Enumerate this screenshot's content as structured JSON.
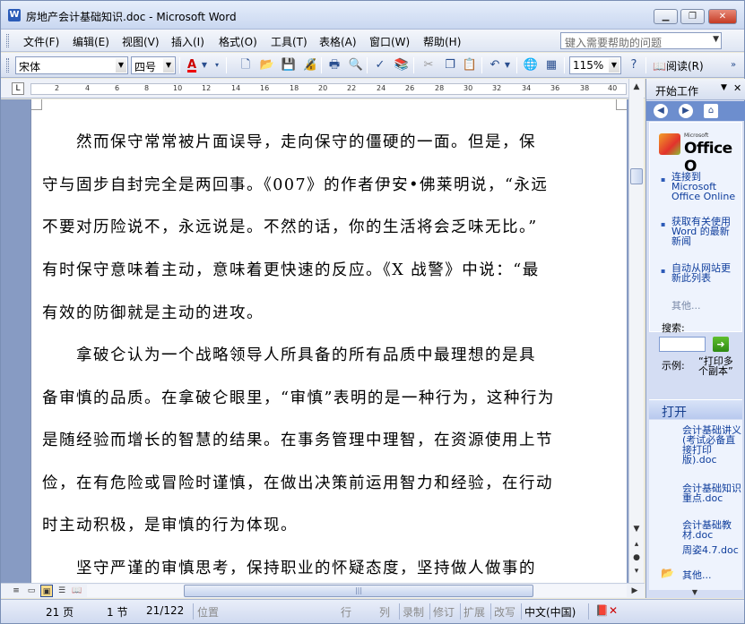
{
  "window": {
    "title": "房地产会计基础知识.doc - Microsoft Word",
    "app_icon": "W",
    "min_icon": "▁",
    "max_icon": "❐",
    "close_icon": "✕"
  },
  "menu": {
    "items": [
      "文件(F)",
      "编辑(E)",
      "视图(V)",
      "插入(I)",
      "格式(O)",
      "工具(T)",
      "表格(A)",
      "窗口(W)",
      "帮助(H)"
    ],
    "help_placeholder": "键入需要帮助的问题"
  },
  "toolbar": {
    "font_name": "宋体",
    "font_size": "四号",
    "font_color_letter": "A",
    "zoom": "115%",
    "read_label": "阅读(R)",
    "icons": [
      "new-icon",
      "open-icon",
      "save-icon",
      "permission-icon",
      "print-icon",
      "print-preview-icon",
      "spelling-icon",
      "research-icon",
      "cut-icon",
      "copy-icon",
      "paste-icon",
      "undo-icon",
      "hyperlink-icon",
      "table-icon",
      "help-icon"
    ]
  },
  "ruler": {
    "corner": "L",
    "ticks": [
      "2",
      "4",
      "6",
      "8",
      "10",
      "12",
      "14",
      "16",
      "18",
      "20",
      "22",
      "24",
      "26",
      "28",
      "30",
      "32",
      "34",
      "36",
      "38",
      "40"
    ]
  },
  "document": {
    "lines": [
      "　　然而保守常常被片面误导，走向保守的僵硬的一面。但是，保",
      "守与固步自封完全是两回事。《007》的作者伊安•佛莱明说，“永远",
      "不要对历险说不，永远说是。不然的话，你的生活将会乏味无比。”",
      "有时保守意味着主动，意味着更快速的反应。《X 战警》中说：“最",
      "有效的防御就是主动的进攻。",
      "　　拿破仑认为一个战略领导人所具备的所有品质中最理想的是具",
      "备审慎的品质。在拿破仑眼里，“审慎”表明的是一种行为，这种行为",
      "是随经验而增长的智慧的结果。在事务管理中理智，在资源使用上节",
      "俭，在有危险或冒险时谨慎，在做出决策前运用智力和经验，在行动",
      "时主动积极，是审慎的行为体现。",
      "　　坚守严谨的审慎思考，保持职业的怀疑态度，坚持做人做事的"
    ]
  },
  "taskpane": {
    "title": "开始工作",
    "office_small": "Microsoft",
    "office_big": "Office O",
    "links": [
      "连接到 Microsoft Office Online",
      "获取有关使用 Word 的最新新闻",
      "自动从网站更新此列表"
    ],
    "more": "其他...",
    "search_label": "搜索:",
    "example_label": "示例:",
    "example_text": "“打印多个副本”",
    "open_title": "打开",
    "open_files": [
      "会计基础讲义(考试必备直接打印版).doc",
      "会计基础知识重点.doc",
      "会计基础教材.doc",
      "周姿4.7.doc"
    ],
    "open_more": "其他..."
  },
  "status": {
    "page": "21 页",
    "section": "1 节",
    "pages": "21/122",
    "position": "位置",
    "line": "行",
    "column": "列",
    "rec": "录制",
    "trk": "修订",
    "ext": "扩展",
    "ovr": "改写",
    "language": "中文(中国)"
  }
}
